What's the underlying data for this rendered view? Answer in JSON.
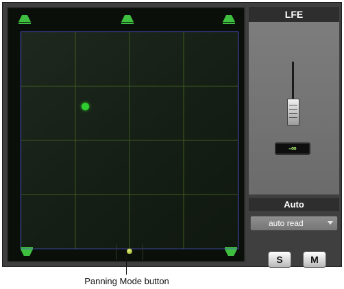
{
  "right_panel": {
    "lfe_label": "LFE",
    "fader_value": "-∞",
    "automation_header": "Auto",
    "automation_mode": "auto read",
    "solo_label": "S",
    "mute_label": "M"
  },
  "callout": {
    "label": "Panning Mode button"
  },
  "colors": {
    "grid_line": "#3f5a1f",
    "grid_border": "#4b54c8",
    "speaker_icon": "#3fbf3f",
    "pan_position": "#2ecc2e",
    "fader_value_text": "#b6ff78"
  },
  "icons": {
    "front_speakers": [
      "speaker-left-icon",
      "speaker-center-icon",
      "speaker-right-icon"
    ],
    "rear_speakers": [
      "speaker-rear-left-icon",
      "speaker-rear-right-icon"
    ]
  }
}
